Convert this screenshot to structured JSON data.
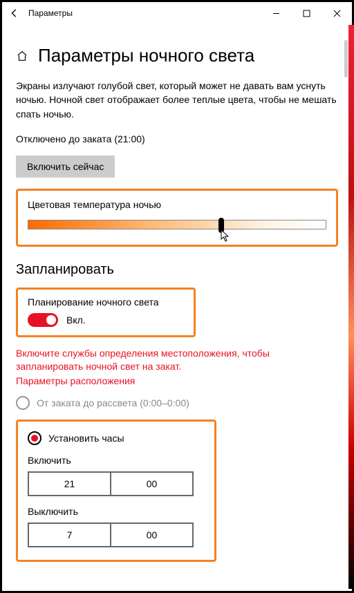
{
  "window": {
    "title": "Параметры"
  },
  "page": {
    "heading": "Параметры ночного света",
    "description": "Экраны излучают голубой свет, который может не давать вам уснуть ночью. Ночной свет отображает более теплые цвета, чтобы не мешать спать ночью.",
    "status": "Отключено до заката (21:00)",
    "enable_now": "Включить сейчас"
  },
  "slider": {
    "label": "Цветовая температура ночью",
    "value_percent": 64
  },
  "schedule": {
    "heading": "Запланировать",
    "toggle_label": "Планирование ночного света",
    "toggle_state_text": "Вкл.",
    "toggle_on": true
  },
  "location_warning": {
    "message": "Включите службы определения местоположения, чтобы запланировать ночной свет на закат.",
    "link": "Параметры расположения"
  },
  "radio": {
    "sunset": "От заката до рассвета (0:00–0:00)",
    "custom": "Установить часы"
  },
  "hours": {
    "on_label": "Включить",
    "on_h": "21",
    "on_m": "00",
    "off_label": "Выключить",
    "off_h": "7",
    "off_m": "00"
  }
}
